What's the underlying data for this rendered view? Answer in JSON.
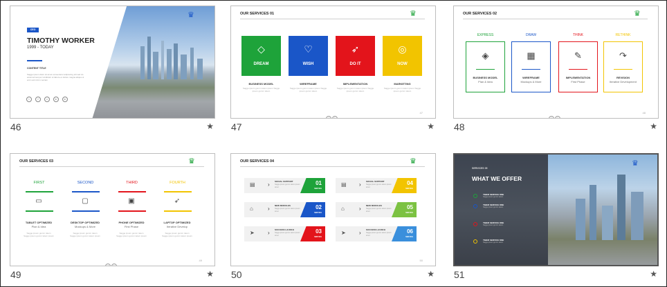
{
  "slides": [
    {
      "number": "46",
      "star": "★",
      "badge": "CEO",
      "title": "TIMOTHY WORKER",
      "years": "1999 - TODAY",
      "content_title": "CONTENT TITLE",
      "body": "Sagge ipsum dolor sit amet consectetur adipiscing elit sed do eiusmod tempor incididunt ut labore et dolore magna aliqua ut enim ad minim veniam",
      "social": [
        "t",
        "f",
        "v",
        "in",
        "in"
      ]
    },
    {
      "number": "47",
      "star": "★",
      "header": "OUR SERVICES 01",
      "boxes": [
        {
          "label": "DREAM",
          "caption": "BUSINESS MODEL",
          "color": "#1ea33a",
          "icon": "diamond-icon",
          "glyph": "◇"
        },
        {
          "label": "WISH",
          "caption": "WIREFRAME",
          "color": "#1a56c8",
          "icon": "heart-icon",
          "glyph": "♡"
        },
        {
          "label": "DO IT",
          "caption": "IMPLEMENTATION",
          "color": "#e3141b",
          "icon": "rocket-icon",
          "glyph": "➶"
        },
        {
          "label": "NOW",
          "caption": "MARKETING",
          "color": "#f2c400",
          "icon": "target-icon",
          "glyph": "◎"
        }
      ],
      "filler": "Sagge ipsum gumm tatem ipsum Sagge ipsum gumm tatem",
      "nav": [
        "‹",
        "›"
      ],
      "page": "47"
    },
    {
      "number": "48",
      "star": "★",
      "header": "OUR SERVICES 02",
      "cols": [
        {
          "head": "EXPRESS",
          "label": "BUSINESS MODEL",
          "sub": "Plan & Idea",
          "color": "#1ea33a",
          "icon": "layers-icon",
          "glyph": "◈"
        },
        {
          "head": "DRAW",
          "label": "WIREFRAME",
          "sub": "Mockups & More",
          "color": "#1a56c8",
          "icon": "grid-icon",
          "glyph": "▦"
        },
        {
          "head": "THINK",
          "label": "IMPLEMENTATION",
          "sub": "First Phase",
          "color": "#e3141b",
          "icon": "pencil-icon",
          "glyph": "✎"
        },
        {
          "head": "RETHINK",
          "label": "REVISION",
          "sub": "Iterative Development",
          "color": "#f2c400",
          "icon": "arrow-icon",
          "glyph": "↷"
        }
      ],
      "nav": [
        "‹",
        "›"
      ],
      "page": "48"
    },
    {
      "number": "49",
      "star": "★",
      "header": "OUR SERVICES 03",
      "cols": [
        {
          "head": "FIRST",
          "label": "TABLET OPTIMIZED",
          "sub": "Plan & Idea",
          "color": "#1ea33a",
          "icon": "tablet-icon",
          "glyph": "▭"
        },
        {
          "head": "SECOND",
          "label": "DESKTOP OPTIMIZED",
          "sub": "Mockups & More",
          "color": "#1a56c8",
          "icon": "monitor-icon",
          "glyph": "▢"
        },
        {
          "head": "THIRD",
          "label": "PHONE OPTIMIZED",
          "sub": "First Phase",
          "color": "#e3141b",
          "icon": "image-icon",
          "glyph": "▣"
        },
        {
          "head": "FOURTH",
          "label": "LAPTOP OPTIMIZED",
          "sub": "Iterative Develop",
          "color": "#f2c400",
          "icon": "rocket-icon",
          "glyph": "➶"
        }
      ],
      "filler": "Sagge ipsum gumm tatem Sagge ipsum gumm tatem ipsum",
      "nav": [
        "‹",
        "›"
      ],
      "page": "49"
    },
    {
      "number": "50",
      "star": "★",
      "header": "OUR SERVICES 04",
      "rows": [
        {
          "n": "01",
          "s": "SERVICE",
          "title": "SOCIAL SUPPORT",
          "color": "#1ea33a",
          "icon": "briefcase-icon",
          "glyph": "▤"
        },
        {
          "n": "04",
          "s": "SERVICE",
          "title": "SOCIAL SUPPORT",
          "color": "#f2c400",
          "icon": "briefcase-icon",
          "glyph": "▤"
        },
        {
          "n": "02",
          "s": "SERVICE",
          "title": "NEW MODULES",
          "color": "#1a56c8",
          "icon": "store-icon",
          "glyph": "⌂"
        },
        {
          "n": "05",
          "s": "SERVICE",
          "title": "NEW MODULES",
          "color": "#7cc242",
          "icon": "store-icon",
          "glyph": "⌂"
        },
        {
          "n": "03",
          "s": "SERVICE",
          "title": "SUCCESS LAUNCH",
          "color": "#e3141b",
          "icon": "send-icon",
          "glyph": "➤"
        },
        {
          "n": "06",
          "s": "SERVICE",
          "title": "SUCCESS LAUNCH",
          "color": "#3a8fdc",
          "icon": "send-icon",
          "glyph": "➤"
        }
      ],
      "row_sub": "Sagge ipsum gumm tatem ipsum amet",
      "arrow": "›",
      "page": "50"
    },
    {
      "number": "51",
      "star": "★",
      "sub": "SERVICES 05",
      "title": "WHAT WE OFFER",
      "items": [
        {
          "title": "TIBER SERVICE ONE",
          "sub": "Sagge ipsum gumm tatem",
          "color": "#1ea33a"
        },
        {
          "title": "TIBER SERVICE ONE",
          "sub": "Sagge ipsum gumm tatem",
          "color": "#1a56c8"
        },
        {
          "title": "TIBER SERVICE ONE",
          "sub": "Sagge ipsum gumm tatem",
          "color": "#e3141b"
        },
        {
          "title": "TIBER SERVICE ONE",
          "sub": "Sagge ipsum gumm tatem",
          "color": "#f2c400"
        }
      ]
    }
  ],
  "logo_glyph": "♛"
}
